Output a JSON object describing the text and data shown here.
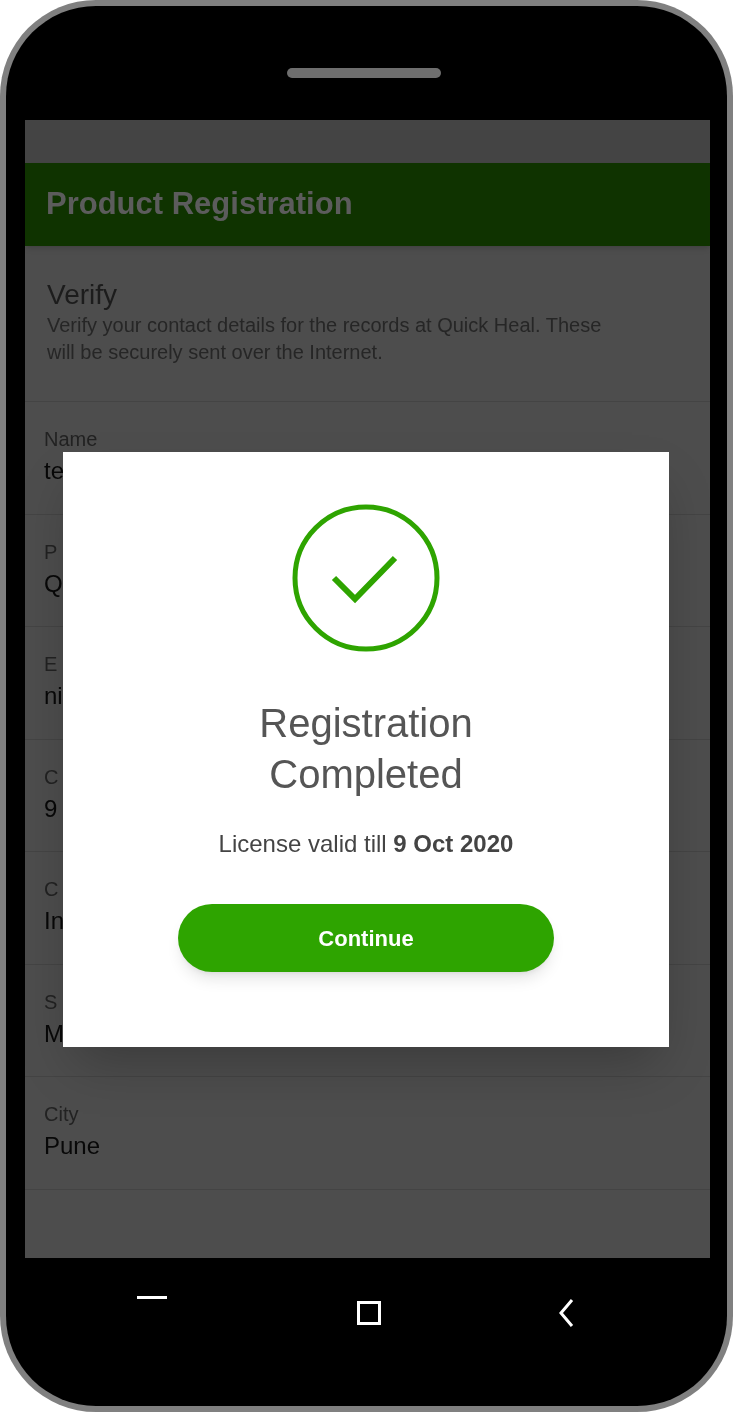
{
  "app_bar": {
    "title": "Product Registration"
  },
  "intro": {
    "heading": "Verify",
    "description": "Verify your contact details for the records at Quick Heal. These will be securely sent over the Internet."
  },
  "fields": [
    {
      "label": "Name",
      "value": "te"
    },
    {
      "label": "P",
      "value": "Q"
    },
    {
      "label": "E",
      "value": "ni"
    },
    {
      "label": "C",
      "value": "9"
    },
    {
      "label": "C",
      "value": "In"
    },
    {
      "label": "S",
      "value": "M"
    },
    {
      "label": "City",
      "value": "Pune"
    }
  ],
  "dialog": {
    "title": "Registration Completed",
    "message": "License valid till **9 Oct 2020**",
    "button": "Continue"
  }
}
